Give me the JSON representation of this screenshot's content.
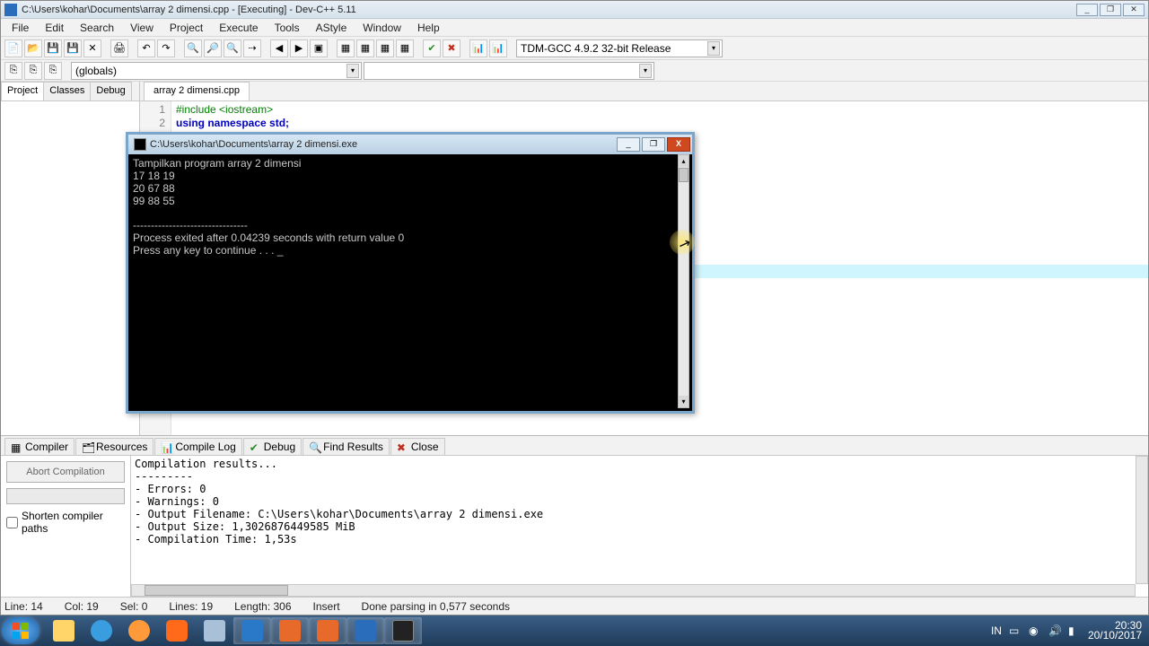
{
  "window": {
    "title": "C:\\Users\\kohar\\Documents\\array 2 dimensi.cpp - [Executing] - Dev-C++ 5.11"
  },
  "menu": {
    "items": [
      "File",
      "Edit",
      "Search",
      "View",
      "Project",
      "Execute",
      "Tools",
      "AStyle",
      "Window",
      "Help"
    ]
  },
  "compiler_combo": "TDM-GCC 4.9.2 32-bit Release",
  "globals_combo": "(globals)",
  "sidetabs": [
    "Project",
    "Classes",
    "Debug"
  ],
  "editor_tab": "array 2 dimensi.cpp",
  "code": {
    "line1_no": "1",
    "line1_a": "#include ",
    "line1_b": "<iostream>",
    "line2_no": "2",
    "line2": "using namespace std;"
  },
  "console": {
    "title": "C:\\Users\\kohar\\Documents\\array 2 dimensi.exe",
    "out_l1": "Tampilkan program array 2 dimensi",
    "out_l2": "17 18 19",
    "out_l3": "20 67 88",
    "out_l4": "99 88 55",
    "sep": "--------------------------------",
    "exit": "Process exited after 0.04239 seconds with return value 0",
    "cont": "Press any key to continue . . . _"
  },
  "bottom_tabs": {
    "compiler": "Compiler",
    "resources": "Resources",
    "compilelog": "Compile Log",
    "debug": "Debug",
    "findresults": "Find Results",
    "close": "Close"
  },
  "bottom_left": {
    "abort": "Abort Compilation",
    "shorten": "Shorten compiler paths"
  },
  "compile_output": "Compilation results...\n---------\n- Errors: 0\n- Warnings: 0\n- Output Filename: C:\\Users\\kohar\\Documents\\array 2 dimensi.exe\n- Output Size: 1,3026876449585 MiB\n- Compilation Time: 1,53s",
  "status": {
    "line": "Line:   14",
    "col": "Col:   19",
    "sel": "Sel:   0",
    "lines": "Lines:   19",
    "length": "Length:   306",
    "insert": "Insert",
    "parse": "Done parsing in 0,577 seconds"
  },
  "tray": {
    "lang": "IN",
    "time": "20:30",
    "date": "20/10/2017"
  }
}
